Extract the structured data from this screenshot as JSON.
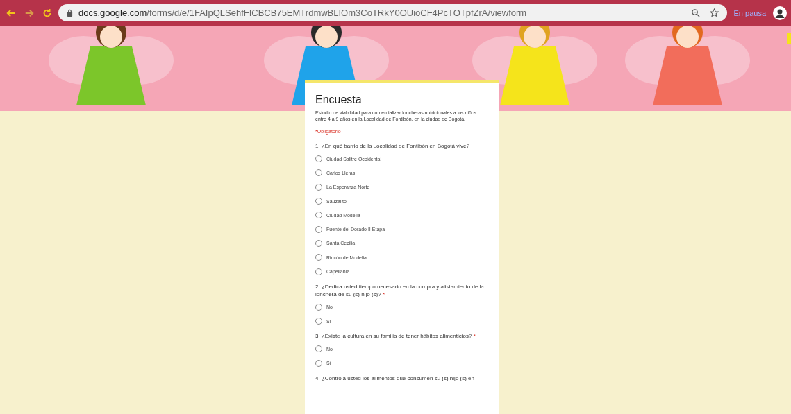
{
  "browser": {
    "host": "docs.google.com",
    "path": "/forms/d/e/1FAIpQLSehfFICBCB75EMTrdmwBLIOm3CoTRkY0OUioCF4PcTOTpfZrA/viewform",
    "profile_status": "En pausa"
  },
  "form": {
    "title": "Encuesta",
    "description": "Estudio de viabilidad para comercializar loncheras nutricionales a los niños entre 4 a 9 años en la Localidad de Fontibón, en la ciudad de Bogotá.",
    "required_note": "*Obligatorio",
    "questions": [
      {
        "text": "1. ¿En qué barrio de la Localidad de Fontibón en Bogotá vive?",
        "options": [
          {
            "label": "Ciudad Salitre Occidental",
            "selected": false
          },
          {
            "label": "Carlos Lleras",
            "selected": false
          },
          {
            "label": "La Esperanza Norte",
            "selected": false
          },
          {
            "label": "Sauzalito",
            "selected": false
          },
          {
            "label": "Ciudad Modelia",
            "selected": false
          },
          {
            "label": "Fuente del Dorado II Etapa",
            "selected": false
          },
          {
            "label": "Santa Cecilia",
            "selected": false
          },
          {
            "label": "Rincón de Modelia",
            "selected": false
          },
          {
            "label": "Capellanía",
            "selected": false
          }
        ]
      },
      {
        "text": "2. ¿Dedica usted tiempo necesario en la compra y alistamiento de la lonchera de su (s) hijo (s)?",
        "required_mark": "*",
        "options": [
          {
            "label": "No",
            "selected": false
          },
          {
            "label": "Sí",
            "selected": false
          }
        ]
      },
      {
        "text": "3. ¿Existe la cultura en su familia de tener hábitos alimenticios?",
        "required_mark": "*",
        "options": [
          {
            "label": "No",
            "selected": false
          },
          {
            "label": "Sí",
            "selected": false
          }
        ]
      },
      {
        "text": "4. ¿Controla usted los alimentos que consumen su (s) hijo (s) en"
      }
    ]
  }
}
